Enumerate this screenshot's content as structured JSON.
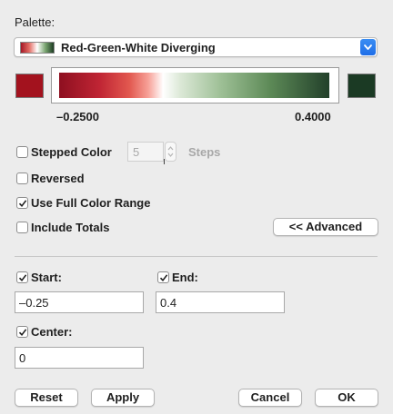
{
  "palette": {
    "label": "Palette:",
    "selected": "Red-Green-White Diverging"
  },
  "range": {
    "min_label": "–0.2500",
    "max_label": "0.4000",
    "min_color": "#a3121e",
    "max_color": "#1b3a24"
  },
  "options": {
    "stepped_color": {
      "label": "Stepped Color",
      "checked": false
    },
    "steps_value": "5",
    "steps_label": "Steps",
    "reversed": {
      "label": "Reversed",
      "checked": false
    },
    "use_full_range": {
      "label": "Use Full Color Range",
      "checked": true
    },
    "include_totals": {
      "label": "Include Totals",
      "checked": false
    },
    "advanced_button": "<< Advanced"
  },
  "limits": {
    "start": {
      "label": "Start:",
      "checked": true,
      "value": "–0.25"
    },
    "end": {
      "label": "End:",
      "checked": true,
      "value": "0.4"
    },
    "center": {
      "label": "Center:",
      "checked": true,
      "value": "0"
    }
  },
  "footer": {
    "reset": "Reset",
    "apply": "Apply",
    "cancel": "Cancel",
    "ok": "OK"
  }
}
